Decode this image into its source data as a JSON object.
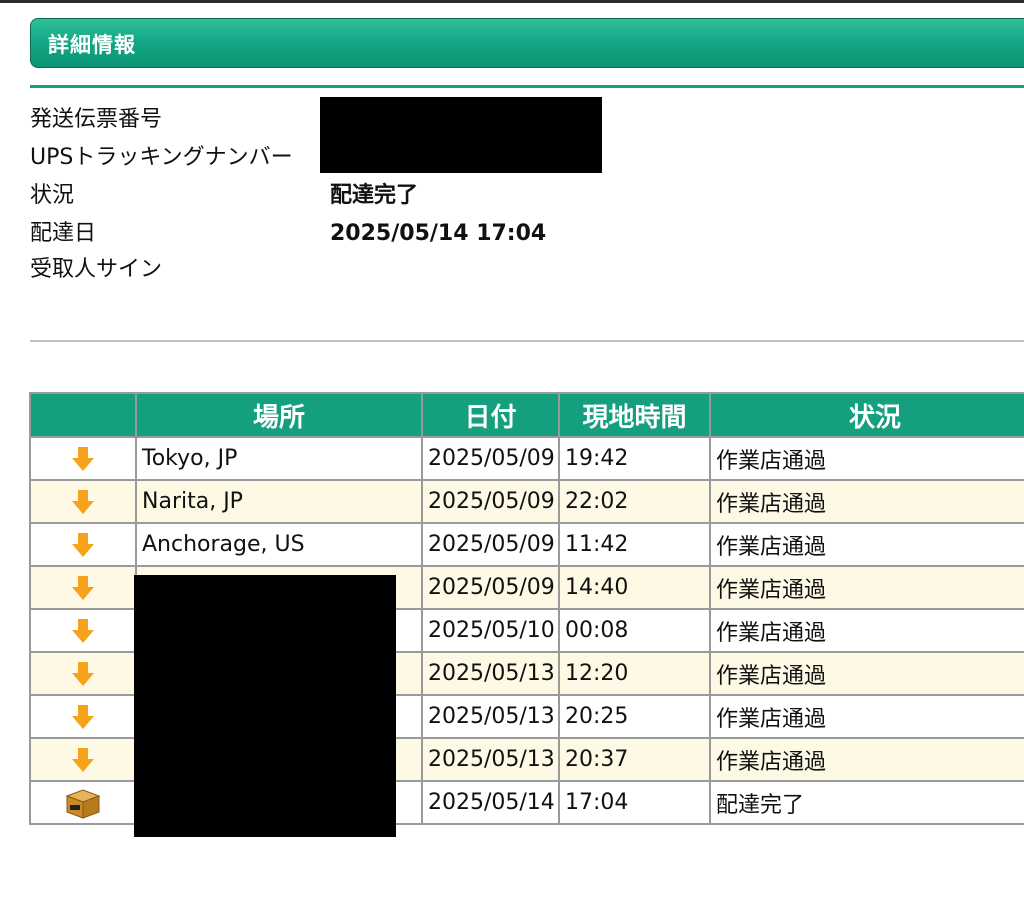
{
  "section": {
    "title": "詳細情報"
  },
  "details": {
    "tracking_label": "発送伝票番号",
    "ups_label": "UPSトラッキングナンバー",
    "status_label": "状況",
    "status_value": "配達完了",
    "delivery_date_label": "配達日",
    "delivery_date_value": "2025/05/14 17:04",
    "signature_label": "受取人サイン"
  },
  "table": {
    "headers": [
      "",
      "場所",
      "日付",
      "現地時間",
      "状況"
    ],
    "rows": [
      {
        "icon": "down-arrow-icon",
        "location": "Tokyo, JP",
        "date": "2025/05/09",
        "time": "19:42",
        "status": "作業店通過"
      },
      {
        "icon": "down-arrow-icon",
        "location": "Narita, JP",
        "date": "2025/05/09",
        "time": "22:02",
        "status": "作業店通過"
      },
      {
        "icon": "down-arrow-icon",
        "location": "Anchorage, US",
        "date": "2025/05/09",
        "time": "11:42",
        "status": "作業店通過"
      },
      {
        "icon": "down-arrow-icon",
        "location": "",
        "date": "2025/05/09",
        "time": "14:40",
        "status": "作業店通過"
      },
      {
        "icon": "down-arrow-icon",
        "location": "",
        "date": "2025/05/10",
        "time": "00:08",
        "status": "作業店通過"
      },
      {
        "icon": "down-arrow-icon",
        "location": "",
        "date": "2025/05/13",
        "time": "12:20",
        "status": "作業店通過"
      },
      {
        "icon": "down-arrow-icon",
        "location": "",
        "date": "2025/05/13",
        "time": "20:25",
        "status": "作業店通過"
      },
      {
        "icon": "down-arrow-icon",
        "location": "",
        "date": "2025/05/13",
        "time": "20:37",
        "status": "作業店通過"
      },
      {
        "icon": "package-box-icon",
        "location": "",
        "date": "2025/05/14",
        "time": "17:04",
        "status": "配達完了"
      }
    ]
  },
  "colors": {
    "header_green": "#14a07f",
    "arrow_orange": "#f6a21a",
    "alt_row": "#fdf9e5"
  }
}
